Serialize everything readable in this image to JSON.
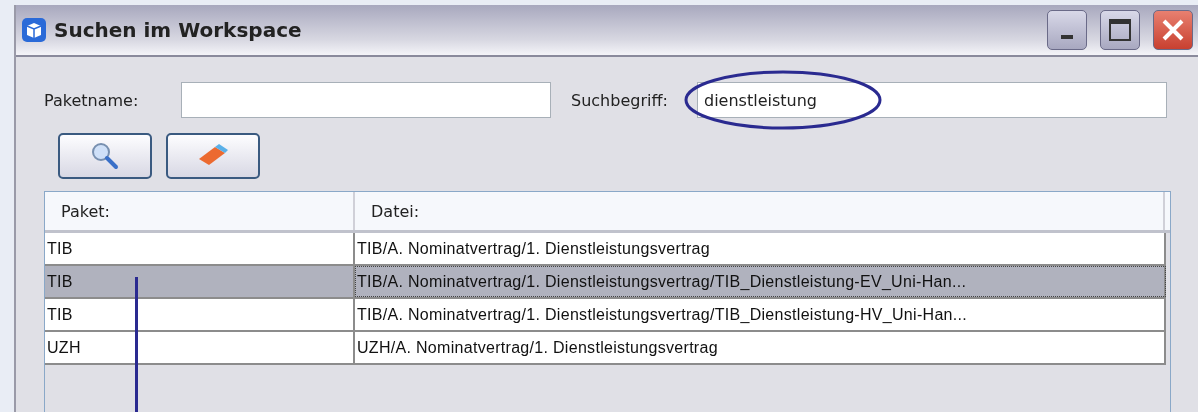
{
  "window": {
    "title": "Suchen im Workspace"
  },
  "form": {
    "package_label": "Paketname:",
    "term_label": "Suchbegriff:",
    "term_value": "dienstleistung"
  },
  "table": {
    "columns": [
      "Paket:",
      "Datei:"
    ],
    "rows": [
      {
        "package": "TIB",
        "file": "TIB/A. Nominatvertrag/1. Dienstleistungsvertrag",
        "selected": false
      },
      {
        "package": "TIB",
        "file": "TIB/A. Nominatvertrag/1. Dienstleistungsvertrag/TIB_Dienstleistung-EV_Uni-Han...",
        "selected": true
      },
      {
        "package": "TIB",
        "file": "TIB/A. Nominatvertrag/1. Dienstleistungsvertrag/TIB_Dienstleistung-HV_Uni-Han...",
        "selected": false
      },
      {
        "package": "UZH",
        "file": "UZH/A. Nominatvertrag/1. Dienstleistungsvertrag",
        "selected": false
      }
    ]
  }
}
